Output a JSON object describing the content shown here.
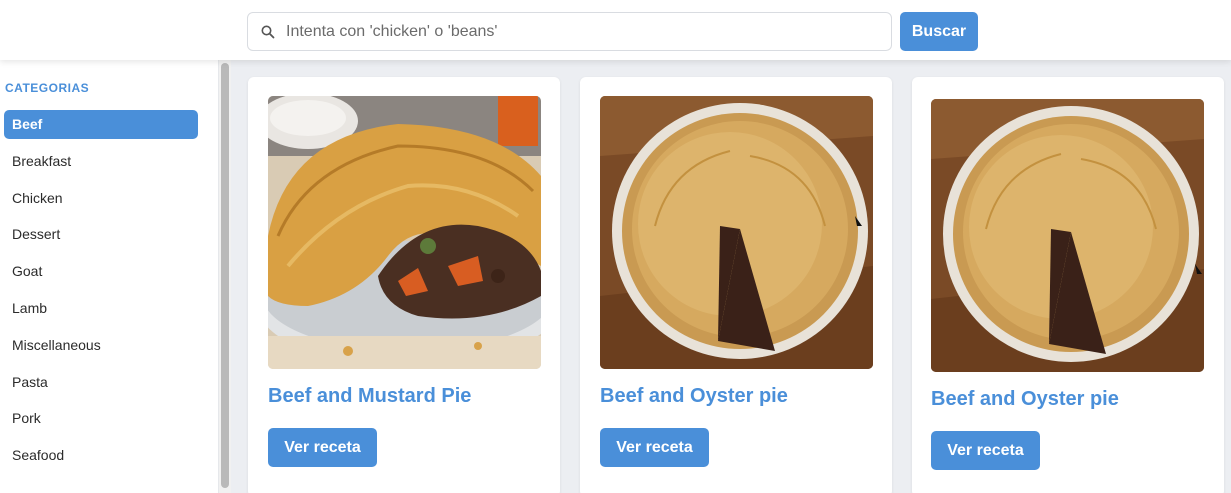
{
  "search": {
    "placeholder": "Intenta con 'chicken' o 'beans'",
    "value": "",
    "button_label": "Buscar"
  },
  "sidebar": {
    "title": "CATEGORIAS",
    "items": [
      {
        "label": "Beef",
        "active": true
      },
      {
        "label": "Breakfast",
        "active": false
      },
      {
        "label": "Chicken",
        "active": false
      },
      {
        "label": "Dessert",
        "active": false
      },
      {
        "label": "Goat",
        "active": false
      },
      {
        "label": "Lamb",
        "active": false
      },
      {
        "label": "Miscellaneous",
        "active": false
      },
      {
        "label": "Pasta",
        "active": false
      },
      {
        "label": "Pork",
        "active": false
      },
      {
        "label": "Seafood",
        "active": false
      }
    ]
  },
  "recipes": [
    {
      "title": "Beef and Mustard Pie",
      "button_label": "Ver receta",
      "image": "beef-mustard-pie-photo"
    },
    {
      "title": "Beef and Oyster pie",
      "button_label": "Ver receta",
      "image": "beef-oyster-pie-photo"
    },
    {
      "title": "Beef and Oyster pie",
      "button_label": "Ver receta",
      "image": "beef-oyster-pie-photo"
    }
  ],
  "colors": {
    "accent": "#4a8fd9",
    "background": "#eceef2",
    "card": "#ffffff"
  }
}
